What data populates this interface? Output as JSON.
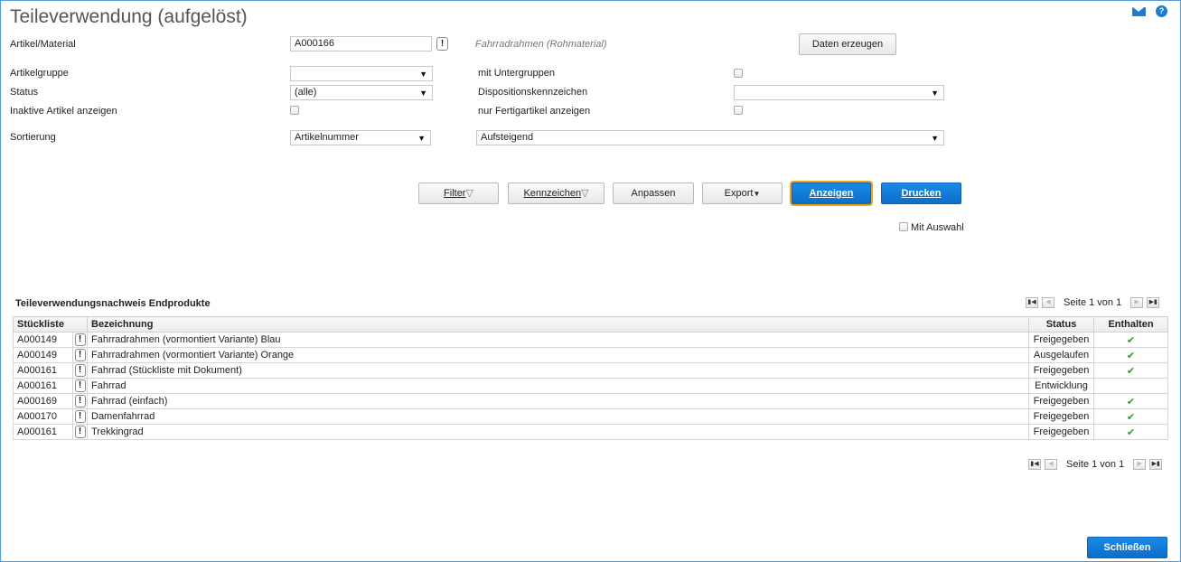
{
  "window": {
    "title": "Teileverwendung (aufgelöst)"
  },
  "header_icons": {
    "mail": "mail-icon",
    "help": "help-icon",
    "help_glyph": "?"
  },
  "form": {
    "artikel_label": "Artikel/Material",
    "artikel_value": "A000166",
    "artikel_desc": "Fahrradrahmen (Rohmaterial)",
    "daten_button": "Daten erzeugen",
    "artikelgruppe_label": "Artikelgruppe",
    "artikelgruppe_value": "",
    "mit_untergruppen_label": "mit Untergruppen",
    "status_label": "Status",
    "status_value": "(alle)",
    "dispo_label": "Dispositionskennzeichen",
    "dispo_value": "",
    "inaktive_label": "Inaktive Artikel anzeigen",
    "fertig_label": "nur Fertigartikel anzeigen",
    "sortierung_label": "Sortierung",
    "sortierung_value": "Artikelnummer",
    "richtung_value": "Aufsteigend"
  },
  "actions": {
    "filter": "Filter",
    "kennzeichen": "Kennzeichen",
    "anpassen": "Anpassen",
    "export": "Export",
    "anzeigen": "Anzeigen",
    "drucken": "Drucken",
    "mit_auswahl": "Mit Auswahl"
  },
  "grid": {
    "title": "Teileverwendungsnachweis Endprodukte",
    "pager_text": "Seite 1 von 1",
    "columns": [
      "Stückliste",
      "Bezeichnung",
      "Status",
      "Enthalten"
    ],
    "rows": [
      {
        "stueckliste": "A000149",
        "bezeichnung": "Fahrradrahmen (vormontiert Variante) Blau",
        "status": "Freigegeben",
        "enthalten": "✔"
      },
      {
        "stueckliste": "A000149",
        "bezeichnung": "Fahrradrahmen (vormontiert Variante) Orange",
        "status": "Ausgelaufen",
        "enthalten": "✔"
      },
      {
        "stueckliste": "A000161",
        "bezeichnung": "Fahrrad (Stückliste mit Dokument)",
        "status": "Freigegeben",
        "enthalten": "✔"
      },
      {
        "stueckliste": "A000161",
        "bezeichnung": "Fahrrad",
        "status": "Entwicklung",
        "enthalten": ""
      },
      {
        "stueckliste": "A000169",
        "bezeichnung": "Fahrrad (einfach)",
        "status": "Freigegeben",
        "enthalten": "✔"
      },
      {
        "stueckliste": "A000170",
        "bezeichnung": "Damenfahrrad",
        "status": "Freigegeben",
        "enthalten": "✔"
      },
      {
        "stueckliste": "A000161",
        "bezeichnung": "Trekkingrad",
        "status": "Freigegeben",
        "enthalten": "✔"
      }
    ],
    "info_glyph": "!"
  },
  "footer": {
    "schliessen": "Schließen"
  },
  "colors": {
    "accent": "#0a6fcb",
    "focus": "#f0a30a",
    "check": "#2a9d2a"
  }
}
